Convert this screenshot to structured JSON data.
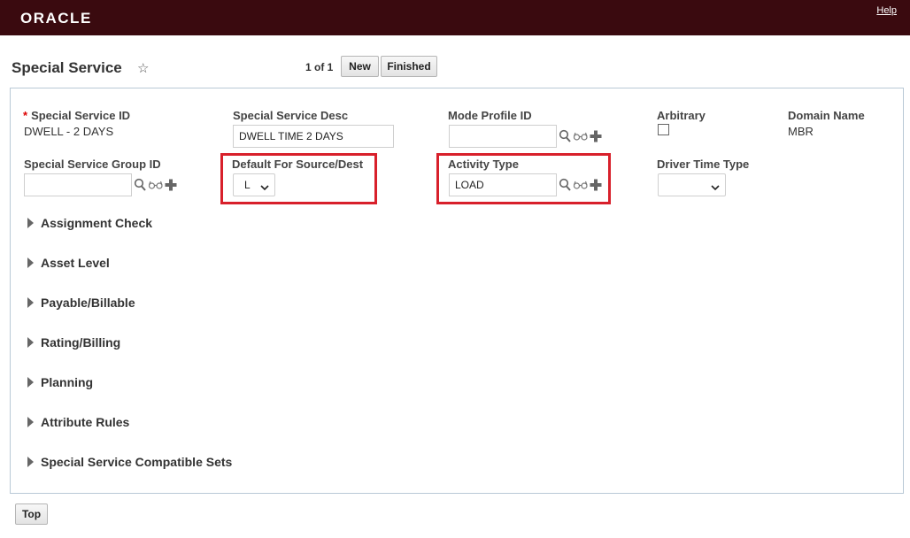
{
  "header": {
    "logo": "ORACLE",
    "help": "Help"
  },
  "page": {
    "title": "Special Service",
    "pager": "1 of 1",
    "new_label": "New",
    "finished_label": "Finished"
  },
  "fields": {
    "special_service_id": {
      "label": "Special Service ID",
      "required_mark": "*",
      "value": "DWELL - 2 DAYS"
    },
    "special_service_desc": {
      "label": "Special Service Desc",
      "value": "DWELL TIME 2 DAYS"
    },
    "mode_profile_id": {
      "label": "Mode Profile ID",
      "value": ""
    },
    "arbitrary": {
      "label": "Arbitrary",
      "checked": false
    },
    "domain_name": {
      "label": "Domain Name",
      "value": "MBR"
    },
    "special_service_group_id": {
      "label": "Special Service Group ID",
      "value": ""
    },
    "default_for_source_dest": {
      "label": "Default For Source/Dest",
      "value": "L"
    },
    "activity_type": {
      "label": "Activity Type",
      "value": "LOAD"
    },
    "driver_time_type": {
      "label": "Driver Time Type",
      "value": ""
    }
  },
  "sections": [
    "Assignment Check",
    "Asset Level",
    "Payable/Billable",
    "Rating/Billing",
    "Planning",
    "Attribute Rules",
    "Special Service Compatible Sets"
  ],
  "footer": {
    "top_label": "Top"
  },
  "colors": {
    "header_bg": "#3a0a0f",
    "highlight": "#d8202b",
    "panel_border": "#b9c9d6"
  },
  "icons": [
    "search-icon",
    "glasses-icon",
    "plus-icon",
    "star-icon",
    "chevron-down-icon",
    "triangle-right-icon"
  ]
}
